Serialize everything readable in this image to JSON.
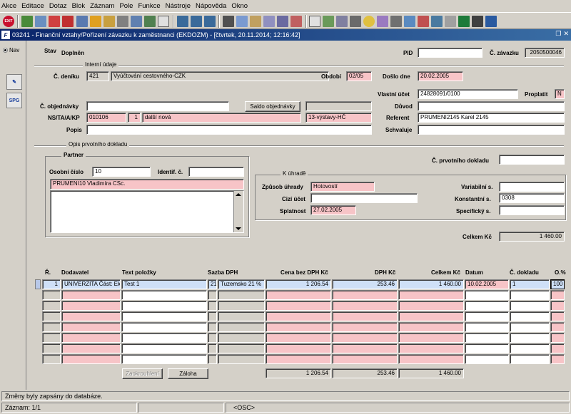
{
  "menu": [
    "Akce",
    "Editace",
    "Dotaz",
    "Blok",
    "Záznam",
    "Pole",
    "Funkce",
    "Nástroje",
    "Nápověda",
    "Okno"
  ],
  "window": {
    "title": "03241 - Finanční vztahy/Pořízení závazku k zaměstnanci (EKDOZM) - [čtvrtek, 20.11.2014; 12:16:42]",
    "icon": "F"
  },
  "nav": {
    "label": "Nav",
    "spg": "SPG"
  },
  "header": {
    "stav_label": "Stav",
    "stav_value": "Doplněn",
    "pid_label": "PID",
    "pid_value": "",
    "cislo_zavazku_label": "Č. závazku",
    "cislo_zavazku_value": "2050500046"
  },
  "interni": {
    "title": "Interní údaje",
    "denik_label": "Č. deníku",
    "denik_code": "421",
    "denik_name": "Vyúčtování cestovného-CZK",
    "obdobi_label": "Období",
    "obdobi_value": "02/05",
    "doslo_label": "Došlo dne",
    "doslo_value": "20.02.2005"
  },
  "ucet": {
    "vlastni_label": "Vlastní účet",
    "vlastni_value": "24828091/0100",
    "proplatit_label": "Proplatit",
    "proplatit_value": "N"
  },
  "objednavka": {
    "label": "Č. objednávky",
    "value": "",
    "saldo_button": "Saldo objednávky",
    "saldo_value": ""
  },
  "duvod": {
    "label": "Důvod",
    "value": ""
  },
  "ns": {
    "label": "NS/TA/A/KP",
    "ns": "010106",
    "ta": "1",
    "a": "další nová",
    "kp": "13-výstavy-HČ"
  },
  "referent": {
    "label": "Referent",
    "value": "PRUMENI2145 Karel 2145"
  },
  "popis": {
    "label": "Popis",
    "value": ""
  },
  "schvaluje": {
    "label": "Schvaluje",
    "value": ""
  },
  "opis": {
    "title": "Opis prvotního dokladu",
    "prvotni_label": "Č. prvotního dokladu",
    "prvotni_value": ""
  },
  "partner": {
    "title": "Partner",
    "osobni_label": "Osobní číslo",
    "osobni_value": "10",
    "identif_label": "Identif. č.",
    "identif_value": "",
    "name": "PRUMENI10 Vladimíra CSc."
  },
  "uhrada": {
    "title": "K úhradě",
    "zpusob_label": "Způsob úhrady",
    "zpusob_value": "Hotovostí",
    "cizi_label": "Cizí účet",
    "cizi_value": "",
    "splatnost_label": "Splatnost",
    "splatnost_value": "27.02.2005",
    "variabilni_label": "Variabilní s.",
    "variabilni_value": "",
    "konstantni_label": "Konstantní s.",
    "konstantni_value": "0308",
    "specificky_label": "Specifický s.",
    "specificky_value": ""
  },
  "celkem": {
    "label": "Celkem Kč",
    "value": "1 460.00"
  },
  "table": {
    "headers": {
      "r": "Ř.",
      "dodavatel": "Dodavatel",
      "text": "Text položky",
      "sazba": "Sazba DPH",
      "cena": "Cena bez DPH Kč",
      "dph": "DPH Kč",
      "celkem": "Celkem Kč",
      "datum": "Datum",
      "doklad": "Č. dokladu",
      "pct": "O.%"
    },
    "row1": {
      "r": "1",
      "dodavatel": "UNIVERZITA Část: Ek",
      "text": "Test 1",
      "sazba_code": "21",
      "sazba_name": "Tuzemsko 21 %",
      "cena": "1 206.54",
      "dph": "253.46",
      "celkem": "1 460.00",
      "datum": "10.02.2005",
      "doklad": "1",
      "pct": "100"
    },
    "totals": {
      "cena": "1 206.54",
      "dph": "253.46",
      "celkem": "1 460.00"
    },
    "zaokrouhleni_button": "Zaokrouhlení",
    "zaloha_button": "Záloha"
  },
  "status": {
    "message": "Změny byly zapsány do databáze.",
    "zaznam": "Záznam: 1/1",
    "osc": "<OSC>"
  },
  "colors": {
    "required": "#f7c4c7",
    "titlebar": "#0a246a",
    "face": "#d4d0c8"
  }
}
